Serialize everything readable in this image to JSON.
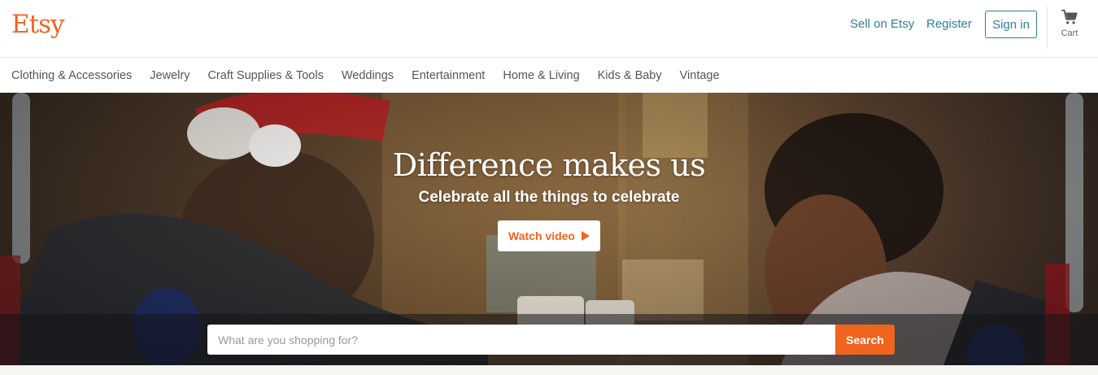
{
  "brand": {
    "logo_text": "Etsy",
    "accent_color": "#f1641e",
    "link_color": "#2e8094"
  },
  "header": {
    "sell_link": "Sell on Etsy",
    "register_link": "Register",
    "signin_button": "Sign in",
    "cart_label": "Cart",
    "cart_icon": "cart-icon"
  },
  "categories": [
    "Clothing & Accessories",
    "Jewelry",
    "Craft Supplies & Tools",
    "Weddings",
    "Entertainment",
    "Home & Living",
    "Kids & Baby",
    "Vintage"
  ],
  "hero": {
    "title": "Difference makes us",
    "subtitle": "Celebrate all the things to celebrate",
    "watch_button": "Watch video",
    "play_icon": "play-icon"
  },
  "search": {
    "placeholder": "What are you shopping for?",
    "value": "",
    "button_label": "Search"
  }
}
